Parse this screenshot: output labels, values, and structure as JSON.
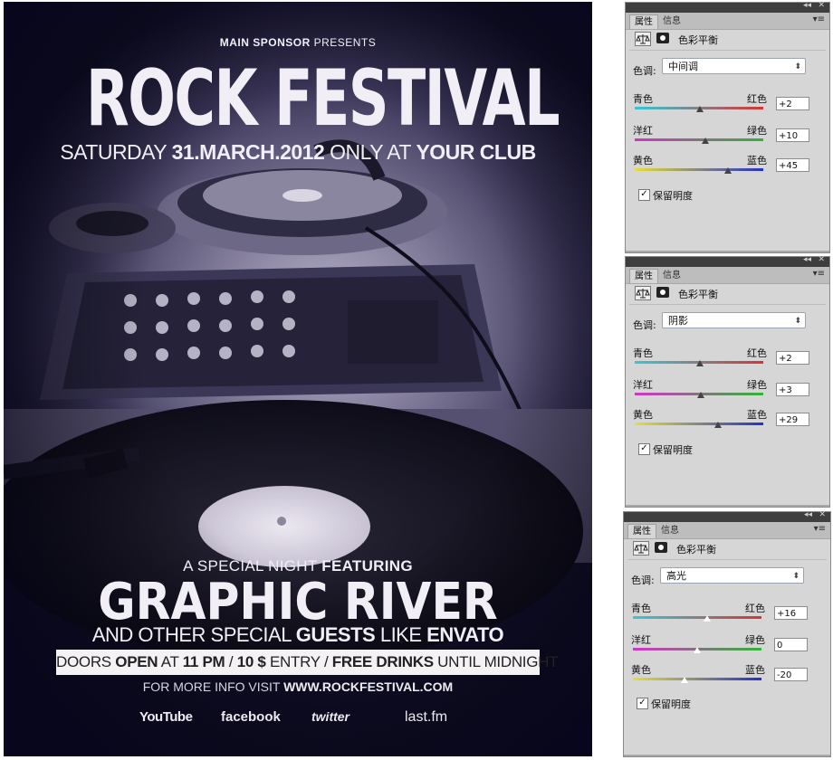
{
  "poster": {
    "sponsor": {
      "bold": "MAIN SPONSOR",
      "rest": " PRESENTS"
    },
    "title": "ROCK FESTIVAL",
    "dateline": {
      "p1": "SATURDAY ",
      "b1": "31.MARCH.2012",
      "p2": " ONLY AT ",
      "b2": "YOUR CLUB"
    },
    "special": {
      "p1": "A SPECIAL NIGHT ",
      "b1": "FEATURING"
    },
    "headliner": "GRAPHIC RIVER",
    "guests": {
      "p1": "AND OTHER SPECIAL ",
      "b1": "GUESTS",
      "p2": " LIKE ",
      "b2": "ENVATO"
    },
    "doors": {
      "p1": "DOORS ",
      "b1": "OPEN",
      "p2": " AT ",
      "b2": "11 PM",
      "p3": " / ",
      "b3": "10 $",
      "p4": " ENTRY / ",
      "b4": "FREE DRINKS",
      "p5": " UNTIL MIDNIGHT"
    },
    "more_info": {
      "p1": "FOR MORE INFO VISIT ",
      "b1": "WWW.ROCKFESTIVAL.COM"
    },
    "social": {
      "youtube": "YouTube",
      "facebook": "facebook",
      "twitter": "twitter",
      "lastfm": "last.fm"
    }
  },
  "panels": [
    {
      "tabs": {
        "properties": "属性",
        "info": "信息"
      },
      "title": "色彩平衡",
      "tone_label": "色调:",
      "tone_value": "中间调",
      "sliders": [
        {
          "left": "青色",
          "right": "红色",
          "value": "+2",
          "pos": 2,
          "colors": [
            "#35c8d6",
            "#d63434"
          ]
        },
        {
          "left": "洋红",
          "right": "绿色",
          "value": "+10",
          "pos": 10,
          "colors": [
            "#d433c8",
            "#33b23a"
          ]
        },
        {
          "left": "黄色",
          "right": "蓝色",
          "value": "+45",
          "pos": 45,
          "colors": [
            "#e6e033",
            "#2430c8"
          ]
        }
      ],
      "preserve_label": "保留明度",
      "preserve_checked": "✓",
      "thumb_style": "dark"
    },
    {
      "tabs": {
        "properties": "属性",
        "info": "信息"
      },
      "title": "色彩平衡",
      "tone_label": "色调:",
      "tone_value": "阴影",
      "sliders": [
        {
          "left": "青色",
          "right": "红色",
          "value": "+2",
          "pos": 2,
          "colors": [
            "#35c8d6",
            "#d63434"
          ]
        },
        {
          "left": "洋红",
          "right": "绿色",
          "value": "+3",
          "pos": 3,
          "colors": [
            "#d433c8",
            "#33b23a"
          ]
        },
        {
          "left": "黄色",
          "right": "蓝色",
          "value": "+29",
          "pos": 29,
          "colors": [
            "#e6e033",
            "#2430c8"
          ]
        }
      ],
      "preserve_label": "保留明度",
      "preserve_checked": "✓",
      "thumb_style": "dark"
    },
    {
      "tabs": {
        "properties": "属性",
        "info": "信息"
      },
      "title": "色彩平衡",
      "tone_label": "色调:",
      "tone_value": "高光",
      "sliders": [
        {
          "left": "青色",
          "right": "红色",
          "value": "+16",
          "pos": 16,
          "colors": [
            "#35c8d6",
            "#d63434"
          ]
        },
        {
          "left": "洋红",
          "right": "绿色",
          "value": "0",
          "pos": 0,
          "colors": [
            "#d433c8",
            "#33b23a"
          ]
        },
        {
          "left": "黄色",
          "right": "蓝色",
          "value": "-20",
          "pos": -20,
          "colors": [
            "#e6e033",
            "#2430c8"
          ]
        }
      ],
      "preserve_label": "保留明度",
      "preserve_checked": "✓",
      "thumb_style": "hollow"
    }
  ]
}
